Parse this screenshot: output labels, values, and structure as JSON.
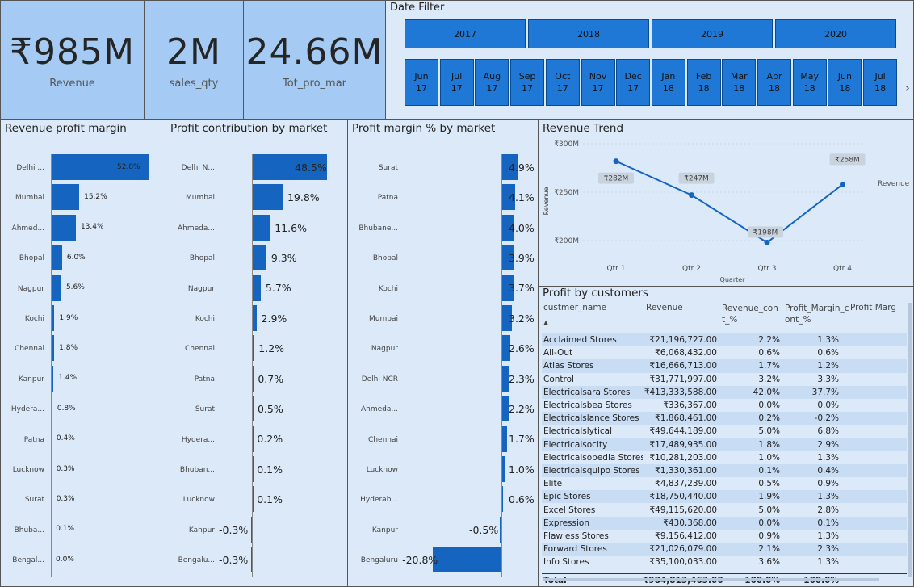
{
  "kpis": [
    {
      "value": "₹985M",
      "label": "Revenue"
    },
    {
      "value": "2M",
      "label": "sales_qty"
    },
    {
      "value": "24.66M",
      "label": "Tot_pro_mar"
    }
  ],
  "date_filter": {
    "title": "Date Filter",
    "years": [
      "2017",
      "2018",
      "2019",
      "2020"
    ],
    "months": [
      {
        "m": "Jun",
        "y": "17"
      },
      {
        "m": "Jul",
        "y": "17"
      },
      {
        "m": "Aug",
        "y": "17"
      },
      {
        "m": "Sep",
        "y": "17"
      },
      {
        "m": "Oct",
        "y": "17"
      },
      {
        "m": "Nov",
        "y": "17"
      },
      {
        "m": "Dec",
        "y": "17"
      },
      {
        "m": "Jan",
        "y": "18"
      },
      {
        "m": "Feb",
        "y": "18"
      },
      {
        "m": "Mar",
        "y": "18"
      },
      {
        "m": "Apr",
        "y": "18"
      },
      {
        "m": "May",
        "y": "18"
      },
      {
        "m": "Jun",
        "y": "18"
      },
      {
        "m": "Jul",
        "y": "18"
      }
    ],
    "next_icon": "chevron-right-icon"
  },
  "accent_color": "#1565c0",
  "chart_data": [
    {
      "type": "bar",
      "title": "Revenue profit margin",
      "categories": [
        "Delhi ...",
        "Mumbai",
        "Ahmed...",
        "Bhopal",
        "Nagpur",
        "Kochi",
        "Chennai",
        "Kanpur",
        "Hydera...",
        "Patna",
        "Lucknow",
        "Surat",
        "Bhuba...",
        "Bengal..."
      ],
      "values": [
        52.8,
        15.2,
        13.4,
        6.0,
        5.6,
        1.9,
        1.8,
        1.4,
        0.8,
        0.4,
        0.3,
        0.3,
        0.1,
        0.0
      ],
      "labels": [
        "52.8%",
        "15.2%",
        "13.4%",
        "6.0%",
        "5.6%",
        "1.9%",
        "1.8%",
        "1.4%",
        "0.8%",
        "0.4%",
        "0.3%",
        "0.3%",
        "0.1%",
        "0.0%"
      ]
    },
    {
      "type": "bar",
      "title": "Profit contribution by market",
      "categories": [
        "Delhi N...",
        "Mumbai",
        "Ahmeda...",
        "Bhopal",
        "Nagpur",
        "Kochi",
        "Chennai",
        "Patna",
        "Surat",
        "Hydera...",
        "Bhuban...",
        "Lucknow",
        "Kanpur",
        "Bengalu..."
      ],
      "values": [
        48.5,
        19.8,
        11.6,
        9.3,
        5.7,
        2.9,
        1.2,
        0.7,
        0.5,
        0.2,
        0.1,
        0.1,
        -0.3,
        -0.3
      ],
      "labels": [
        "48.5%",
        "19.8%",
        "11.6%",
        "9.3%",
        "5.7%",
        "2.9%",
        "1.2%",
        "0.7%",
        "0.5%",
        "0.2%",
        "0.1%",
        "0.1%",
        "-0.3%",
        "-0.3%"
      ]
    },
    {
      "type": "bar",
      "title": "Profit margin % by market",
      "categories": [
        "Surat",
        "Patna",
        "Bhubane...",
        "Bhopal",
        "Kochi",
        "Mumbai",
        "Nagpur",
        "Delhi NCR",
        "Ahmeda...",
        "Chennai",
        "Lucknow",
        "Hyderab...",
        "Kanpur",
        "Bengaluru"
      ],
      "values": [
        4.9,
        4.1,
        4.0,
        3.9,
        3.7,
        3.2,
        2.6,
        2.3,
        2.2,
        1.7,
        1.0,
        0.6,
        -0.5,
        -20.8
      ],
      "labels": [
        "4.9%",
        "4.1%",
        "4.0%",
        "3.9%",
        "3.7%",
        "3.2%",
        "2.6%",
        "2.3%",
        "2.2%",
        "1.7%",
        "1.0%",
        "0.6%",
        "-0.5%",
        "-20.8%"
      ]
    },
    {
      "type": "line",
      "title": "Revenue Trend",
      "xlabel": "Quarter",
      "ylabel": "Revenue",
      "categories": [
        "Qtr 1",
        "Qtr 2",
        "Qtr 3",
        "Qtr 4"
      ],
      "series": [
        {
          "name": "Revenue",
          "values": [
            282,
            247,
            198,
            258
          ],
          "labels": [
            "₹282M",
            "₹247M",
            "₹198M",
            "₹258M"
          ]
        }
      ],
      "yticks": [
        "₹300M",
        "₹250M",
        "₹200M"
      ],
      "ylim": [
        200,
        300
      ]
    }
  ],
  "customers": {
    "title": "Profit by customers",
    "columns": [
      "custmer_name",
      "Revenue",
      "Revenue_con t_%",
      "Profit_Margin_c ont_%",
      "Profit Marg"
    ],
    "sort_icon": "sort-up-icon",
    "rows": [
      [
        "Acclaimed Stores",
        "₹21,196,727.00",
        "2.2%",
        "1.3%"
      ],
      [
        "All-Out",
        "₹6,068,432.00",
        "0.6%",
        "0.6%"
      ],
      [
        "Atlas Stores",
        "₹16,666,713.00",
        "1.7%",
        "1.2%"
      ],
      [
        "Control",
        "₹31,771,997.00",
        "3.2%",
        "3.3%"
      ],
      [
        "Electricalsara Stores",
        "₹413,333,588.00",
        "42.0%",
        "37.7%"
      ],
      [
        "Electricalsbea Stores",
        "₹336,367.00",
        "0.0%",
        "0.0%"
      ],
      [
        "Electricalslance Stores",
        "₹1,868,461.00",
        "0.2%",
        "-0.2%"
      ],
      [
        "Electricalslytical",
        "₹49,644,189.00",
        "5.0%",
        "6.8%"
      ],
      [
        "Electricalsocity",
        "₹17,489,935.00",
        "1.8%",
        "2.9%"
      ],
      [
        "Electricalsopedia Stores",
        "₹10,281,203.00",
        "1.0%",
        "1.3%"
      ],
      [
        "Electricalsquipo Stores",
        "₹1,330,361.00",
        "0.1%",
        "0.4%"
      ],
      [
        "Elite",
        "₹4,837,239.00",
        "0.5%",
        "0.9%"
      ],
      [
        "Epic Stores",
        "₹18,750,440.00",
        "1.9%",
        "1.3%"
      ],
      [
        "Excel Stores",
        "₹49,115,620.00",
        "5.0%",
        "2.8%"
      ],
      [
        "Expression",
        "₹430,368.00",
        "0.0%",
        "0.1%"
      ],
      [
        "Flawless Stores",
        "₹9,156,412.00",
        "0.9%",
        "1.3%"
      ],
      [
        "Forward Stores",
        "₹21,026,079.00",
        "2.1%",
        "2.3%"
      ],
      [
        "Info Stores",
        "₹35,100,033.00",
        "3.6%",
        "1.3%"
      ]
    ],
    "total": [
      "Total",
      "₹984,813,463.00",
      "100.0%",
      "100.0%"
    ]
  }
}
